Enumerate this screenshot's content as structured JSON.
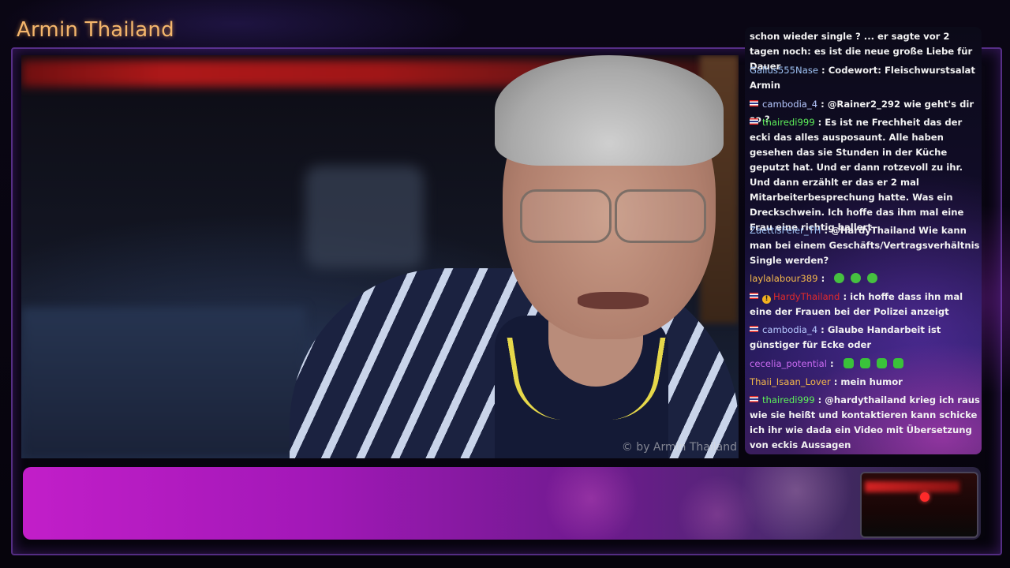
{
  "channel": {
    "title": "Armin Thailand"
  },
  "video": {
    "watermark": "© by Armin Thailand"
  },
  "chat": {
    "messages": [
      {
        "user": "",
        "user_color": "",
        "flag": false,
        "badge": false,
        "text": "schon wieder single ? ... er sagte vor 2 tagen noch: es ist die neue große Liebe für Dauer",
        "emotes": 0
      },
      {
        "user": "Gallus555Nase",
        "user_color": "#9ec2f4",
        "flag": false,
        "badge": false,
        "text": "Codewort: Fleischwurstsalat Armin",
        "emotes": 0
      },
      {
        "user": "cambodia_4",
        "user_color": "#b6c8ff",
        "flag": true,
        "badge": false,
        "text": "@Rainer2_292 wie geht's dir so ?",
        "emotes": 0
      },
      {
        "user": "thairedi999",
        "user_color": "#5ef05a",
        "flag": true,
        "badge": false,
        "text": "Es ist ne Frechheit das der ecki das alles ausposaunt. Alle haben gesehen das sie Stunden in der Küche geputzt hat. Und er dann rotzevoll zu ihr. Und dann erzählt er das er 2 mal Mitarbeiterbesprechung hatte. Was ein Dreckschwein. Ich hoffe das ihm mal eine Frau eine richtig ballert",
        "emotes": 0
      },
      {
        "user": "ZaettisFeier_TH",
        "user_color": "#9ec2f4",
        "flag": false,
        "badge": false,
        "text": "@HardyThailand Wie kann man bei einem Geschäfts/Vertragsverhältnis Single werden?",
        "emotes": 0
      },
      {
        "user": "laylalabour389",
        "user_color": "#f4b84a",
        "flag": false,
        "badge": false,
        "text": "",
        "emotes": 3
      },
      {
        "user": "HardyThailand",
        "user_color": "#e02a2a",
        "flag": true,
        "badge": true,
        "text": "ich hoffe dass ihn mal eine der Frauen bei der Polizei anzeigt",
        "emotes": 0
      },
      {
        "user": "cambodia_4",
        "user_color": "#b6c8ff",
        "flag": true,
        "badge": false,
        "text": "Glaube Handarbeit ist günstiger für Ecke oder",
        "emotes": 0
      },
      {
        "user": "cecelia_potential",
        "user_color": "#c86af0",
        "flag": false,
        "badge": false,
        "text": "",
        "emotes": 4
      },
      {
        "user": "Thaii_Isaan_Lover",
        "user_color": "#f4b84a",
        "flag": false,
        "badge": false,
        "text": "mein humor",
        "emotes": 0
      },
      {
        "user": "thairedi999",
        "user_color": "#5ef05a",
        "flag": true,
        "badge": false,
        "text": "@hardythailand krieg ich raus wie sie heißt und kontaktieren kann schicke ich ihr wie dada ein Video mit Übersetzung von eckis Aussagen",
        "emotes": 0
      }
    ]
  }
}
